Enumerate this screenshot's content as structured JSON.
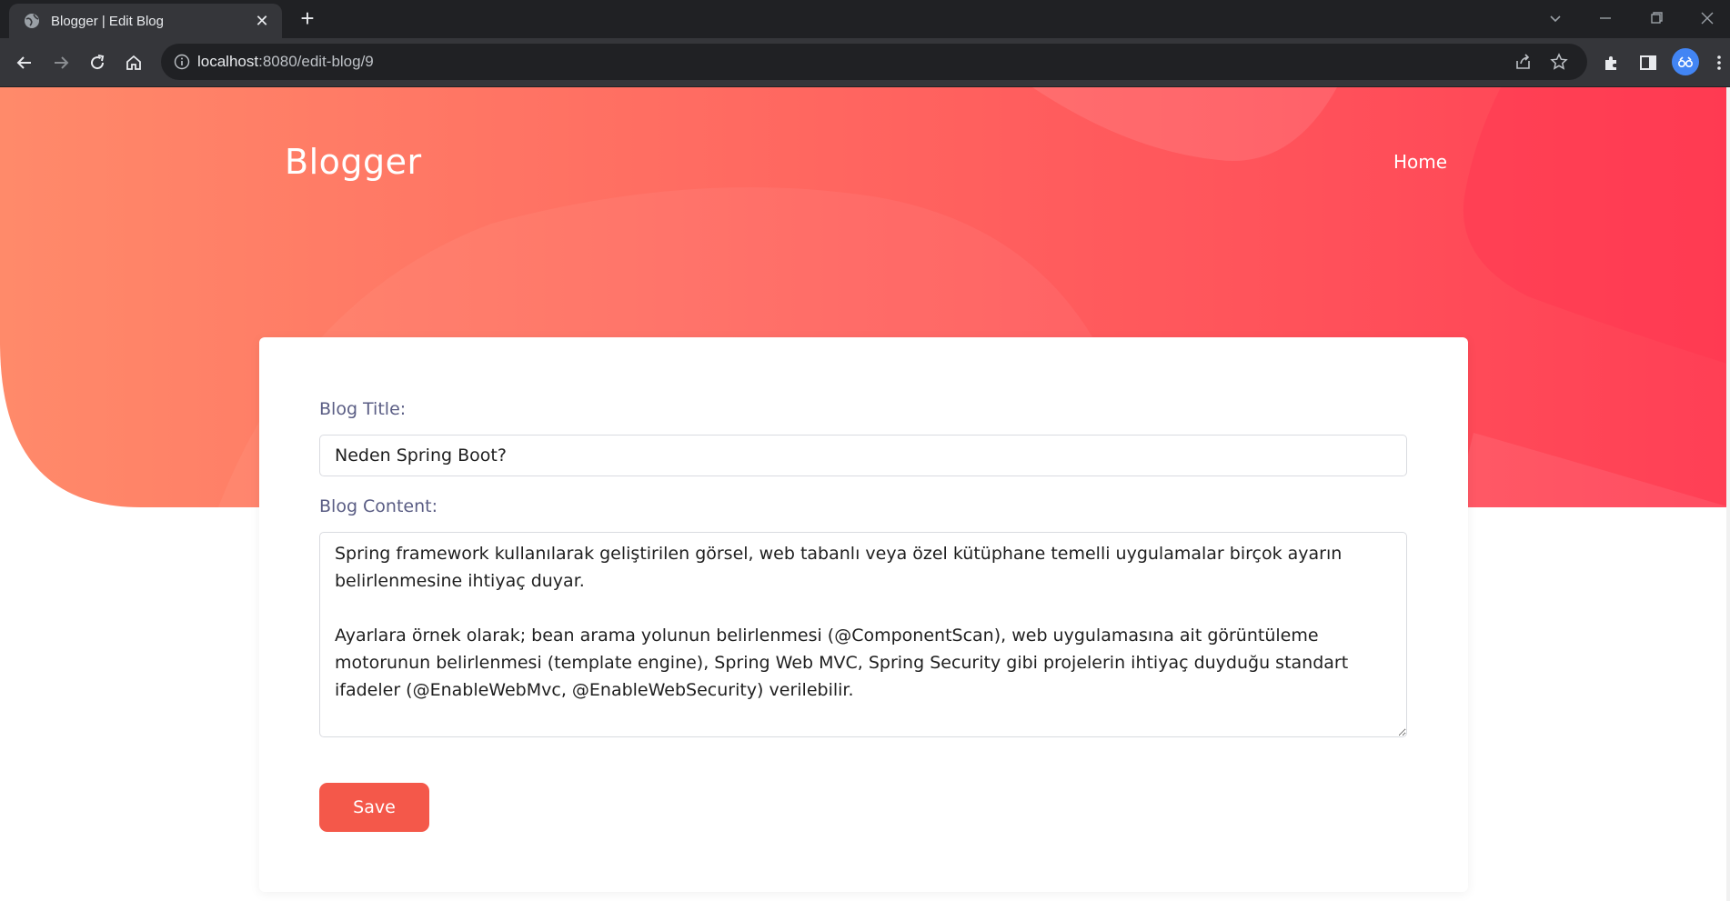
{
  "browser": {
    "tab_title": "Blogger | Edit Blog",
    "url_host": "localhost",
    "url_path": ":8080/edit-blog/9"
  },
  "navbar": {
    "brand": "Blogger",
    "home_link": "Home"
  },
  "form": {
    "title_label": "Blog Title:",
    "title_value": "Neden Spring Boot?",
    "content_label": "Blog Content:",
    "content_value": "Spring framework kullanılarak geliştirilen görsel, web tabanlı veya özel kütüphane temelli uygulamalar birçok ayarın belirlenmesine ihtiyaç duyar.\n\nAyarlara örnek olarak; bean arama yolunun belirlenmesi (@ComponentScan), web uygulamasına ait görüntüleme motorunun belirlenmesi (template engine), Spring Web MVC, Spring Security gibi projelerin ihtiyaç duyduğu standart ifadeler (@EnableWebMvc, @EnableWebSecurity) verilebilir.",
    "save_label": "Save"
  },
  "colors": {
    "hero_start": "#ff8a6a",
    "hero_end": "#ff3f55",
    "save_button": "#f4584a",
    "label_text": "#5a5d84"
  }
}
